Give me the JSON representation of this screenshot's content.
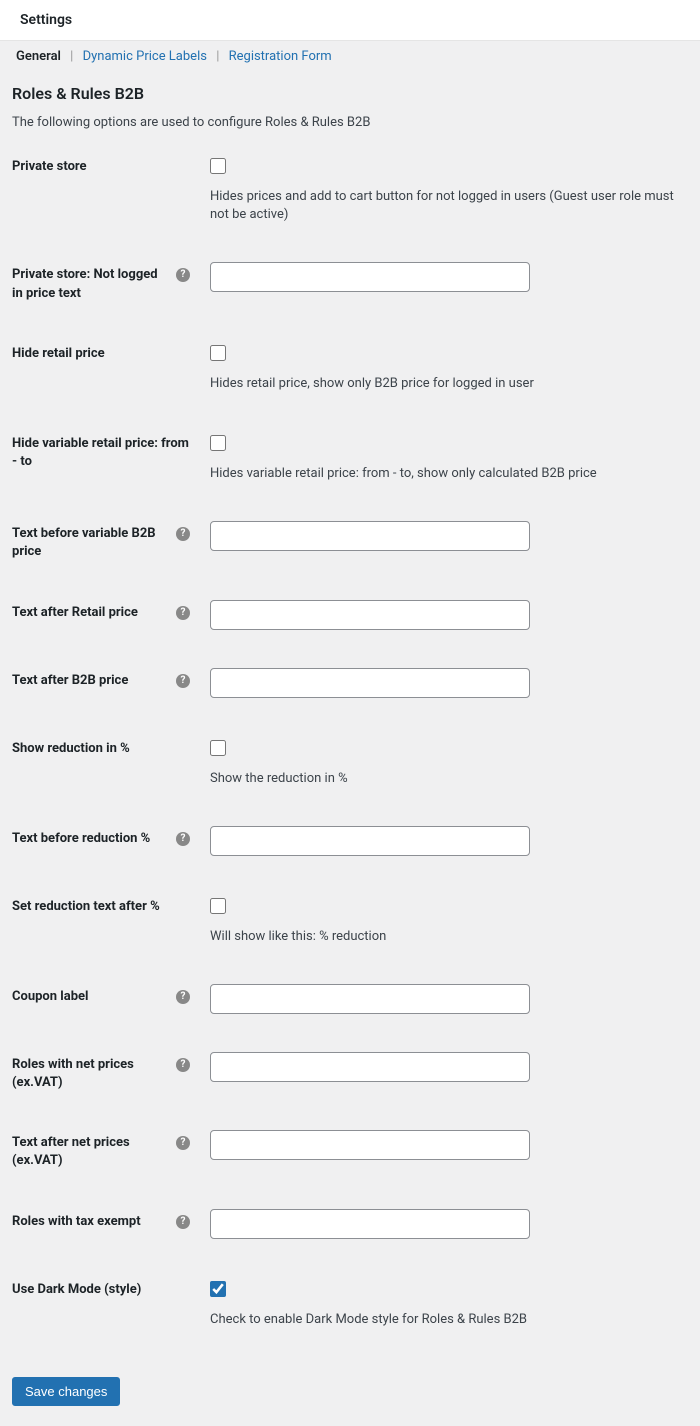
{
  "header": {
    "title": "Settings"
  },
  "tabs": {
    "general": "General",
    "dynamic_price_labels": "Dynamic Price Labels",
    "registration_form": "Registration Form"
  },
  "page": {
    "title": "Roles & Rules B2B",
    "description": "The following options are used to configure Roles & Rules B2B"
  },
  "fields": {
    "private_store": {
      "label": "Private store",
      "desc": "Hides prices and add to cart button for not logged in users (Guest user role must not be active)"
    },
    "private_store_text": {
      "label": "Private store: Not logged in price text",
      "value": ""
    },
    "hide_retail_price": {
      "label": "Hide retail price",
      "desc": "Hides retail price, show only B2B price for logged in user"
    },
    "hide_variable_retail": {
      "label": "Hide variable retail price: from - to",
      "desc": "Hides variable retail price: from - to, show only calculated B2B price"
    },
    "text_before_variable_b2b": {
      "label": "Text before variable B2B price",
      "value": ""
    },
    "text_after_retail": {
      "label": "Text after Retail price",
      "value": ""
    },
    "text_after_b2b": {
      "label": "Text after B2B price",
      "value": ""
    },
    "show_reduction": {
      "label": "Show reduction in %",
      "desc": "Show the reduction in %"
    },
    "text_before_reduction": {
      "label": "Text before reduction %",
      "value": ""
    },
    "set_reduction_text_after": {
      "label": "Set reduction text after %",
      "desc": "Will show like this: % reduction"
    },
    "coupon_label": {
      "label": "Coupon label",
      "value": ""
    },
    "roles_net_prices": {
      "label": "Roles with net prices (ex.VAT)",
      "value": ""
    },
    "text_after_net": {
      "label": "Text after net prices (ex.VAT)",
      "value": ""
    },
    "roles_tax_exempt": {
      "label": "Roles with tax exempt",
      "value": ""
    },
    "use_dark_mode": {
      "label": "Use Dark Mode (style)",
      "desc": "Check to enable Dark Mode style for Roles & Rules B2B"
    }
  },
  "save_button": "Save changes"
}
